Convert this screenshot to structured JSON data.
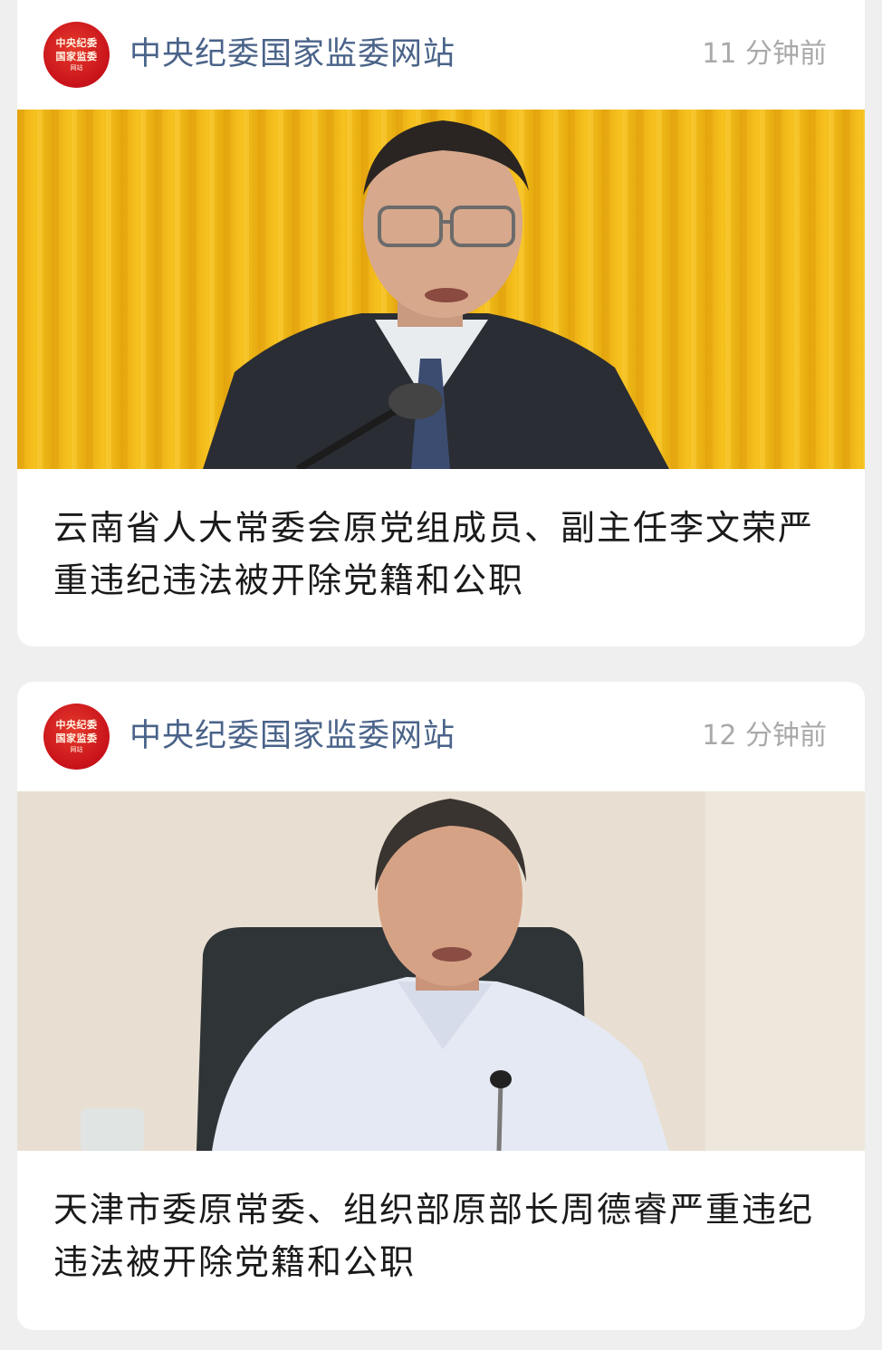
{
  "feed": {
    "items": [
      {
        "logo": {
          "line1": "中央纪委",
          "line2": "国家监委",
          "line3": "网站"
        },
        "source": "中央纪委国家监委网站",
        "time": "11 分钟前",
        "image": {
          "description_icon": "portrait-photo-icon",
          "background_color": "#f3b415"
        },
        "title": "云南省人大常委会原党组成员、副主任李文荣严重违纪违法被开除党籍和公职"
      },
      {
        "logo": {
          "line1": "中央纪委",
          "line2": "国家监委",
          "line3": "网站"
        },
        "source": "中央纪委国家监委网站",
        "time": "12 分钟前",
        "image": {
          "description_icon": "portrait-photo-icon",
          "background_color": "#e6ddd0"
        },
        "title": "天津市委原常委、组织部原部长周德睿严重违纪违法被开除党籍和公职"
      }
    ]
  },
  "colors": {
    "source": "#4a6389",
    "time": "#a9a9a9",
    "logo_red": "#c8121a",
    "background": "#efefef"
  }
}
